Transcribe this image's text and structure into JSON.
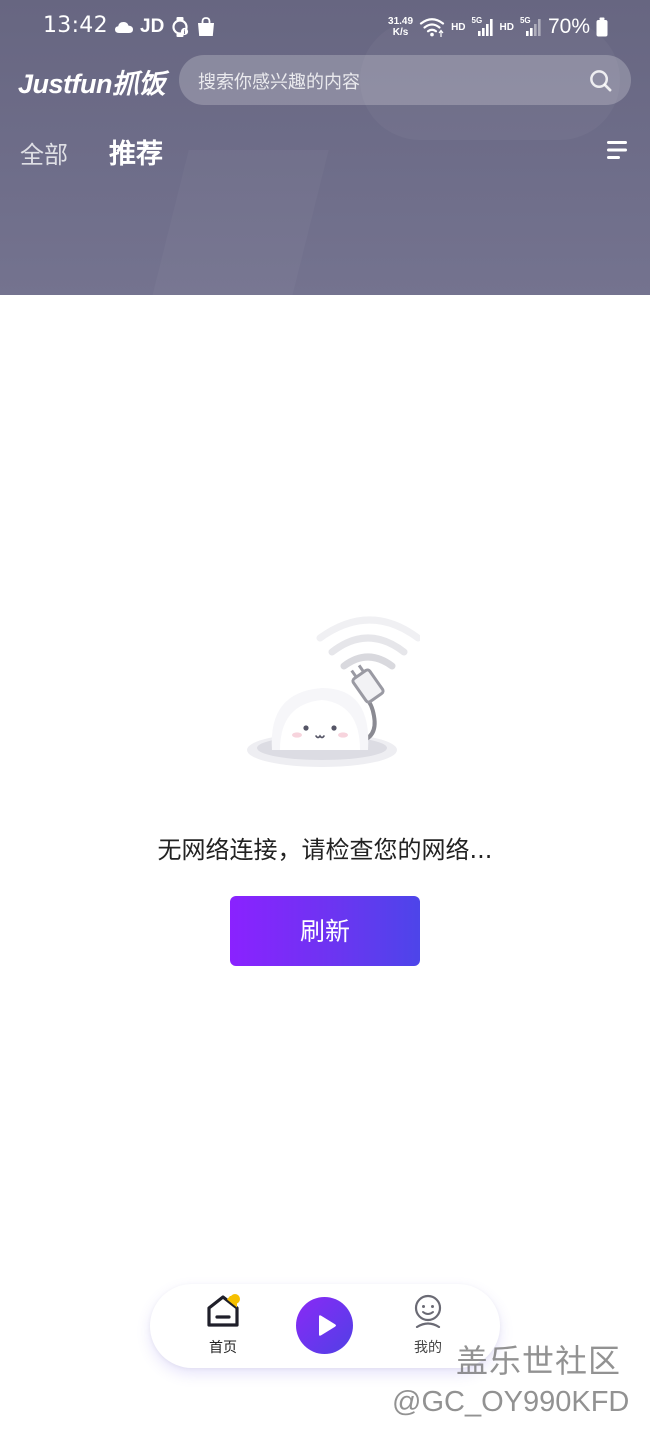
{
  "status_bar": {
    "time": "13:42",
    "left_icons": [
      "cloud-icon",
      "jd-icon",
      "watch-icon",
      "shopping-bag-icon"
    ],
    "jd_label": "JD",
    "net_speed_value": "31.49",
    "net_speed_unit": "K/s",
    "hd_label_1": "HD",
    "hd_label_2": "HD",
    "signal_label_1": "5G",
    "signal_label_2": "5G",
    "battery_percent": "70%"
  },
  "header": {
    "logo_text": "Justfun抓饭",
    "search": {
      "placeholder": "搜索你感兴趣的内容",
      "icon": "search-icon"
    },
    "tabs": [
      {
        "label": "全部",
        "active": false
      },
      {
        "label": "推荐",
        "active": true
      }
    ],
    "menu_icon": "menu-icon",
    "background_color": "#6b6a86"
  },
  "empty_state": {
    "illustration": "no-network-illustration",
    "message": "无网络连接，请检查您的网络...",
    "refresh_label": "刷新",
    "refresh_gradient": [
      "#8a22ff",
      "#4d45ea"
    ]
  },
  "bottom_nav": {
    "items": [
      {
        "label": "首页",
        "icon": "home-icon",
        "active": true
      },
      {
        "label": "",
        "icon": "play-icon",
        "active": false
      },
      {
        "label": "我的",
        "icon": "profile-icon",
        "active": false
      }
    ],
    "accent_color": "#6a36ee",
    "home_accent_color": "#f6c000"
  },
  "watermark": {
    "title": "盖乐世社区",
    "user": "@GC_OY990KFD"
  }
}
